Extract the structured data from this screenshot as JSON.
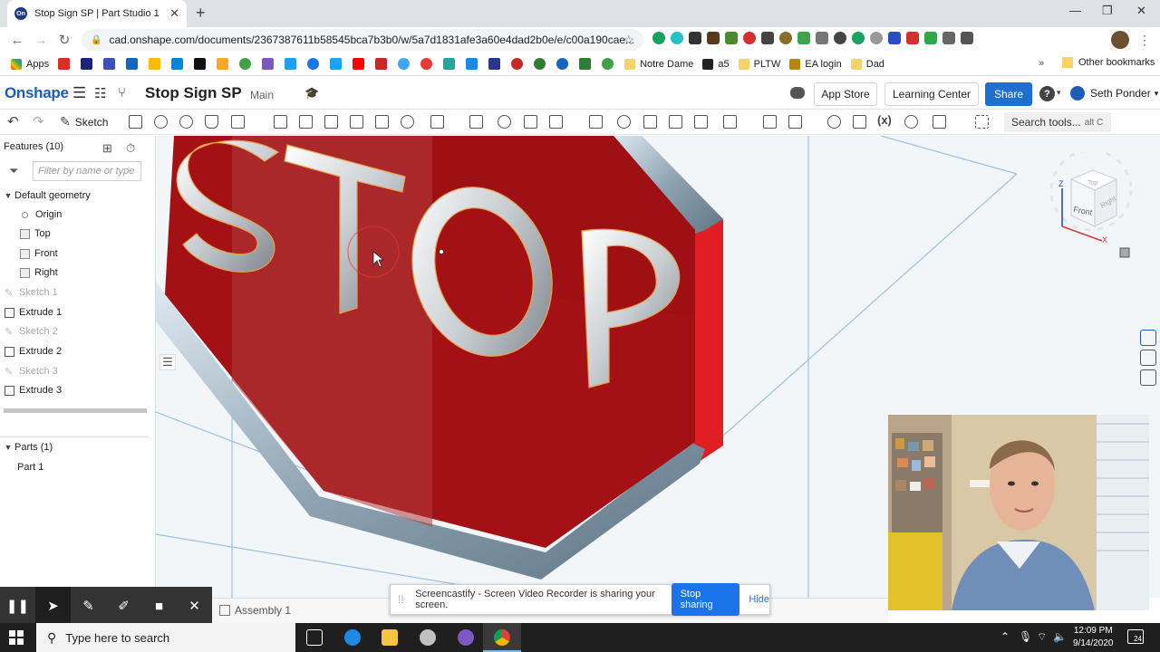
{
  "browser": {
    "tab_title": "Stop Sign SP | Part Studio 1",
    "tab_favicon": "On",
    "url": "cad.onshape.com/documents/2367387611b58545bca7b3b0/w/5a7d1831afe3a60e4dad2b0e/e/c00a190cae...",
    "bookmarks": [
      "Apps",
      "Notre Dame",
      "a5",
      "PLTW",
      "EA login",
      "Dad"
    ],
    "bookmarks_more": "»",
    "other_bookmarks": "Other bookmarks"
  },
  "onshape": {
    "logo": "Onshape",
    "doc_title": "Stop Sign SP",
    "branch": "Main",
    "app_store": "App Store",
    "learning_center": "Learning Center",
    "share": "Share",
    "help": "?",
    "user": "Seth Ponder",
    "sketch": "Sketch",
    "search_tools": "Search tools...",
    "search_shortcut": "alt C",
    "accent_color": "#1f6fd1"
  },
  "features_panel": {
    "header": "Features (10)",
    "filter_placeholder": "Filter by name or type",
    "default_geometry": "Default geometry",
    "origin": "Origin",
    "planes": [
      "Top",
      "Front",
      "Right"
    ],
    "features": [
      {
        "label": "Sketch 1",
        "kind": "sketch"
      },
      {
        "label": "Extrude 1",
        "kind": "extrude"
      },
      {
        "label": "Sketch 2",
        "kind": "sketch"
      },
      {
        "label": "Extrude 2",
        "kind": "extrude"
      },
      {
        "label": "Sketch 3",
        "kind": "sketch"
      },
      {
        "label": "Extrude 3",
        "kind": "extrude"
      }
    ],
    "parts_header": "Parts (1)",
    "parts": [
      "Part 1"
    ]
  },
  "viewport": {
    "model_text": "STOP",
    "viewcube": {
      "top": "Top",
      "front": "Front",
      "right": "Right",
      "axis_z": "Z",
      "axis_x": "X"
    },
    "sign_color": "#a31115"
  },
  "bottom": {
    "assembly_tab": "Assembly 1",
    "share_message": "Screencastify - Screen Video Recorder is sharing your screen.",
    "stop_sharing": "Stop sharing",
    "hide": "Hide"
  },
  "taskbar": {
    "search_placeholder": "Type here to search",
    "time": "12:09 PM",
    "date": "9/14/2020",
    "notifications": "24"
  }
}
